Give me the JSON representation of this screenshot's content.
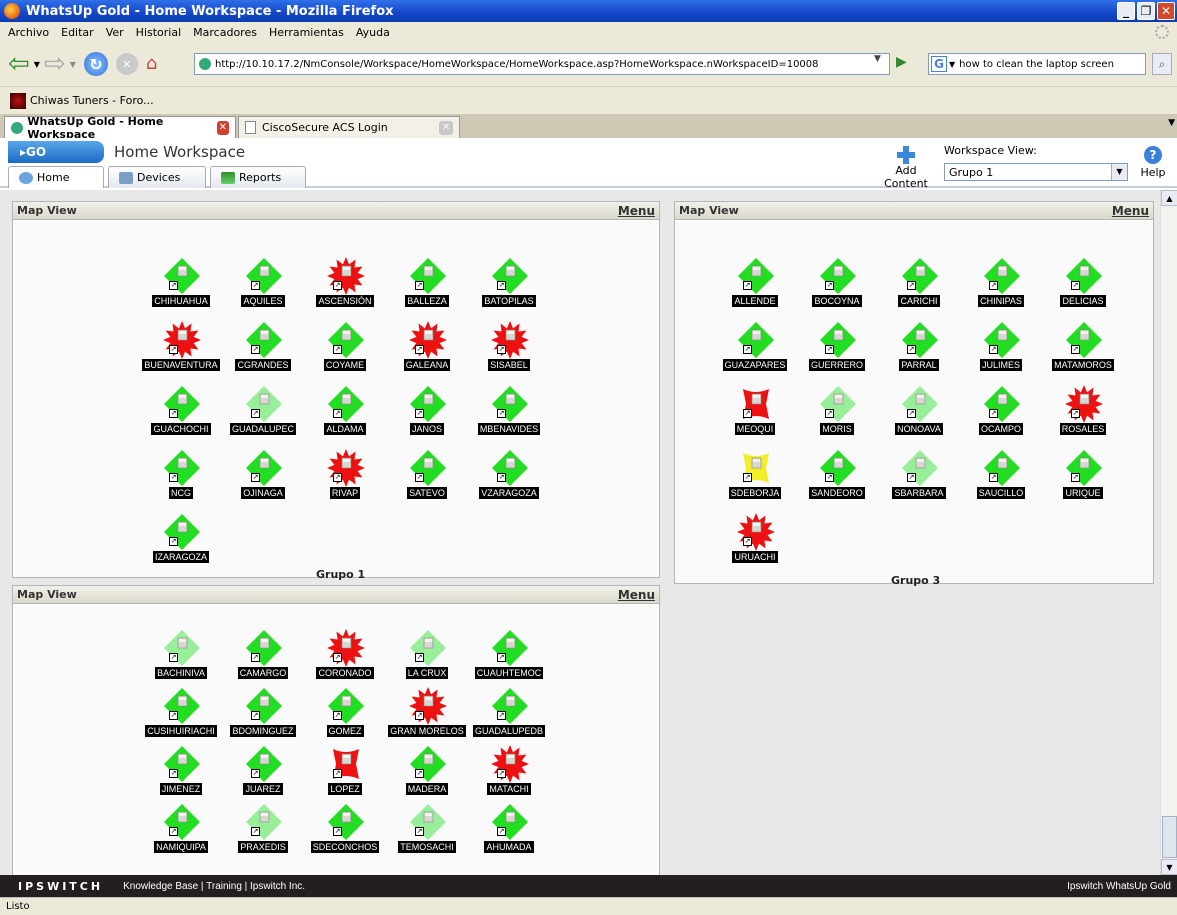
{
  "window": {
    "title": "WhatsUp Gold - Home Workspace - Mozilla Firefox"
  },
  "menubar": [
    "Archivo",
    "Editar",
    "Ver",
    "Historial",
    "Marcadores",
    "Herramientas",
    "Ayuda"
  ],
  "nav": {
    "url": "http://10.10.17.2/NmConsole/Workspace/HomeWorkspace/HomeWorkspace.asp?HomeWorkspace.nWorkspaceID=10008",
    "search_value": "how to clean the laptop screen"
  },
  "bookmarks": {
    "item1": "Chiwas Tuners - Foro..."
  },
  "browser_tabs": {
    "tab1": "WhatsUp Gold - Home Workspace",
    "tab2": "CiscoSecure ACS Login"
  },
  "app": {
    "go_label": "GO",
    "workspace_title": "Home Workspace",
    "tabs": {
      "home": "Home",
      "devices": "Devices",
      "reports": "Reports"
    },
    "add_content": "Add Content",
    "workspace_view_label": "Workspace View:",
    "workspace_view_value": "Grupo 1",
    "help": "Help"
  },
  "panels": [
    {
      "title": "Map View",
      "menu": "Menu",
      "group": "Grupo 1",
      "devices": [
        {
          "name": "CHIHUAHUA",
          "status": "up",
          "shape": "diamond"
        },
        {
          "name": "AQUILES",
          "status": "up",
          "shape": "diamond"
        },
        {
          "name": "ASCENSIÓN",
          "status": "down",
          "shape": "star"
        },
        {
          "name": "BALLEZA",
          "status": "up",
          "shape": "diamond"
        },
        {
          "name": "BATOPILAS",
          "status": "up",
          "shape": "diamond"
        },
        {
          "name": "BUENAVENTURA",
          "status": "down",
          "shape": "star"
        },
        {
          "name": "CGRANDES",
          "status": "up",
          "shape": "diamond"
        },
        {
          "name": "COYAME",
          "status": "up",
          "shape": "diamond"
        },
        {
          "name": "GALEANA",
          "status": "down",
          "shape": "star"
        },
        {
          "name": "SISABEL",
          "status": "down",
          "shape": "star"
        },
        {
          "name": "GUACHOCHI",
          "status": "up",
          "shape": "diamond"
        },
        {
          "name": "GUADALUPEC",
          "status": "maint",
          "shape": "diamond"
        },
        {
          "name": "ALDAMA",
          "status": "up",
          "shape": "diamond"
        },
        {
          "name": "JANOS",
          "status": "up",
          "shape": "diamond"
        },
        {
          "name": "MBENAVIDES",
          "status": "up",
          "shape": "diamond"
        },
        {
          "name": "NCG",
          "status": "up",
          "shape": "diamond"
        },
        {
          "name": "OJINAGA",
          "status": "up",
          "shape": "diamond"
        },
        {
          "name": "RIVAP",
          "status": "down",
          "shape": "star"
        },
        {
          "name": "SATEVO",
          "status": "up",
          "shape": "diamond"
        },
        {
          "name": "VZARAGOZA",
          "status": "up",
          "shape": "diamond"
        },
        {
          "name": "IZARAGOZA",
          "status": "up",
          "shape": "diamond"
        }
      ]
    },
    {
      "title": "Map View",
      "menu": "Menu",
      "group": "Grupo 3",
      "devices": [
        {
          "name": "ALLENDE",
          "status": "up",
          "shape": "diamond"
        },
        {
          "name": "BOCOYNA",
          "status": "up",
          "shape": "diamond"
        },
        {
          "name": "CARICHI",
          "status": "up",
          "shape": "diamond"
        },
        {
          "name": "CHINIPAS",
          "status": "up",
          "shape": "diamond"
        },
        {
          "name": "DELICIAS",
          "status": "up",
          "shape": "diamond"
        },
        {
          "name": "GUAZAPARES",
          "status": "up",
          "shape": "diamond"
        },
        {
          "name": "GUERRERO",
          "status": "up",
          "shape": "diamond"
        },
        {
          "name": "PARRAL",
          "status": "up",
          "shape": "diamond"
        },
        {
          "name": "JULIMES",
          "status": "up",
          "shape": "diamond"
        },
        {
          "name": "MATAMOROS",
          "status": "up",
          "shape": "diamond"
        },
        {
          "name": "MEOQUI",
          "status": "down",
          "shape": "flag"
        },
        {
          "name": "MORIS",
          "status": "maint",
          "shape": "diamond"
        },
        {
          "name": "NONOAVA",
          "status": "maint",
          "shape": "diamond"
        },
        {
          "name": "OCAMPO",
          "status": "up",
          "shape": "diamond"
        },
        {
          "name": "ROSALES",
          "status": "down",
          "shape": "star"
        },
        {
          "name": "SDEBORJA",
          "status": "warn",
          "shape": "flag"
        },
        {
          "name": "SANDEORO",
          "status": "up",
          "shape": "diamond"
        },
        {
          "name": "SBARBARA",
          "status": "maint",
          "shape": "diamond"
        },
        {
          "name": "SAUCILLO",
          "status": "up",
          "shape": "diamond"
        },
        {
          "name": "URIQUE",
          "status": "up",
          "shape": "diamond"
        },
        {
          "name": "URUACHI",
          "status": "down",
          "shape": "star"
        }
      ]
    },
    {
      "title": "Map View",
      "menu": "Menu",
      "group": "",
      "devices": [
        {
          "name": "BACHINIVA",
          "status": "maint",
          "shape": "diamond"
        },
        {
          "name": "CAMARGO",
          "status": "up",
          "shape": "diamond"
        },
        {
          "name": "CORONADO",
          "status": "down",
          "shape": "star"
        },
        {
          "name": "LA CRUX",
          "status": "maint",
          "shape": "diamond"
        },
        {
          "name": "CUAUHTEMOC",
          "status": "up",
          "shape": "diamond"
        },
        {
          "name": "CUSIHUIRIACHI",
          "status": "up",
          "shape": "diamond"
        },
        {
          "name": "BDOMINGUEZ",
          "status": "up",
          "shape": "diamond"
        },
        {
          "name": "GOMEZ",
          "status": "up",
          "shape": "diamond"
        },
        {
          "name": "GRAN MORELOS",
          "status": "down",
          "shape": "star"
        },
        {
          "name": "GUADALUPEDB",
          "status": "up",
          "shape": "diamond"
        },
        {
          "name": "JIMENEZ",
          "status": "up",
          "shape": "diamond"
        },
        {
          "name": "JUAREZ",
          "status": "up",
          "shape": "diamond"
        },
        {
          "name": "LOPEZ",
          "status": "down",
          "shape": "flag"
        },
        {
          "name": "MADERA",
          "status": "up",
          "shape": "diamond"
        },
        {
          "name": "MATACHI",
          "status": "down",
          "shape": "star"
        },
        {
          "name": "NAMIQUIPA",
          "status": "up",
          "shape": "diamond"
        },
        {
          "name": "PRAXEDIS",
          "status": "maint",
          "shape": "diamond"
        },
        {
          "name": "SDECONCHOS",
          "status": "up",
          "shape": "diamond"
        },
        {
          "name": "TEMOSACHI",
          "status": "maint",
          "shape": "diamond"
        },
        {
          "name": "AHUMADA",
          "status": "up",
          "shape": "diamond"
        }
      ]
    }
  ],
  "colors": {
    "up": "#22dd22",
    "down": "#ee1111",
    "maint": "#99ee99",
    "warn": "#f2ee2a",
    "titlebar": "#1a4fd0",
    "footer": "#231f20"
  },
  "footer": {
    "logo": "IPSWITCH",
    "links": "Knowledge Base  |  Training  |  Ipswitch Inc.",
    "product": "Ipswitch WhatsUp Gold"
  },
  "status": "Listo"
}
